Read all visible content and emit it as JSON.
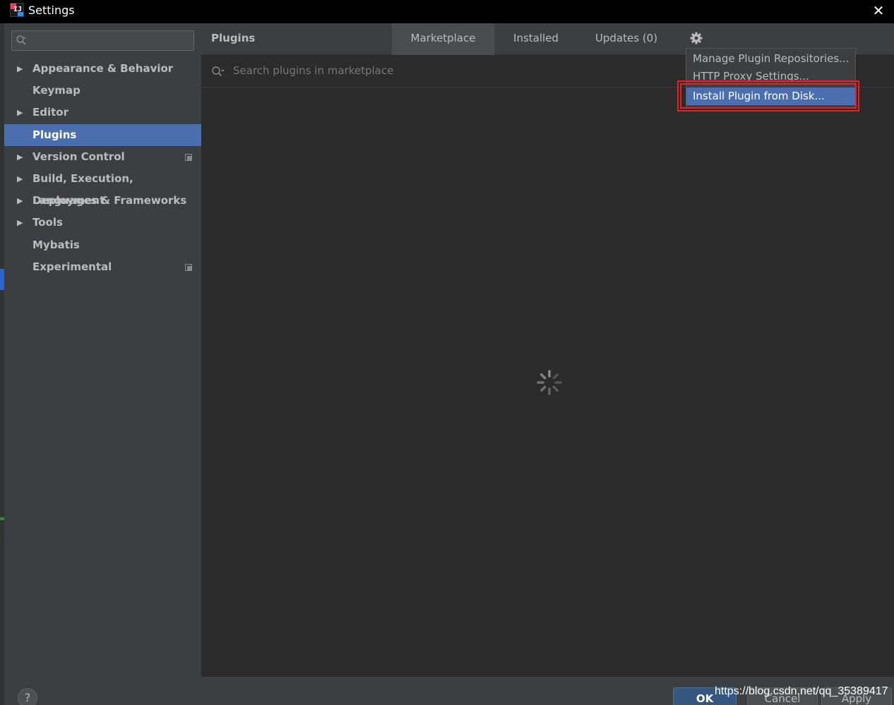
{
  "window": {
    "title": "Settings",
    "close_glyph": "✕",
    "app_icon_text": "IJ"
  },
  "sidebar": {
    "search": {
      "placeholder": ""
    },
    "items": [
      {
        "label": "Appearance & Behavior",
        "expandable": true
      },
      {
        "label": "Keymap",
        "expandable": false
      },
      {
        "label": "Editor",
        "expandable": true
      },
      {
        "label": "Plugins",
        "expandable": false,
        "selected": true
      },
      {
        "label": "Version Control",
        "expandable": true,
        "project_icon": true
      },
      {
        "label": "Build, Execution, Deployment",
        "expandable": true
      },
      {
        "label": "Languages & Frameworks",
        "expandable": true
      },
      {
        "label": "Tools",
        "expandable": true
      },
      {
        "label": "Mybatis",
        "expandable": false
      },
      {
        "label": "Experimental",
        "expandable": false,
        "project_icon": true
      }
    ]
  },
  "main": {
    "title": "Plugins",
    "tabs": [
      {
        "label": "Marketplace",
        "active": true
      },
      {
        "label": "Installed",
        "active": false
      },
      {
        "label": "Updates (0)",
        "active": false
      }
    ],
    "search": {
      "placeholder": "Search plugins in marketplace"
    },
    "loading": true
  },
  "gear_menu": {
    "items": [
      {
        "label": "Manage Plugin Repositories..."
      },
      {
        "label": "HTTP Proxy Settings..."
      },
      {
        "label": "Install Plugin from Disk...",
        "highlighted": true
      }
    ]
  },
  "footer": {
    "help_label": "?",
    "ok_label": "OK",
    "cancel_label": "Cancel",
    "apply_label": "Apply"
  },
  "watermark": "https://blog.csdn.net/qq_35389417",
  "colors": {
    "selection": "#4b6eaf",
    "panel": "#3c3f41",
    "content": "#2b2b2b",
    "annotation": "#e82020"
  },
  "icons": {
    "close": "close-icon",
    "search": "search-icon",
    "gear": "gear-icon",
    "expand": "chevron-right-icon",
    "project": "project-level-icon",
    "loading": "spinner-icon",
    "help": "help-icon"
  }
}
